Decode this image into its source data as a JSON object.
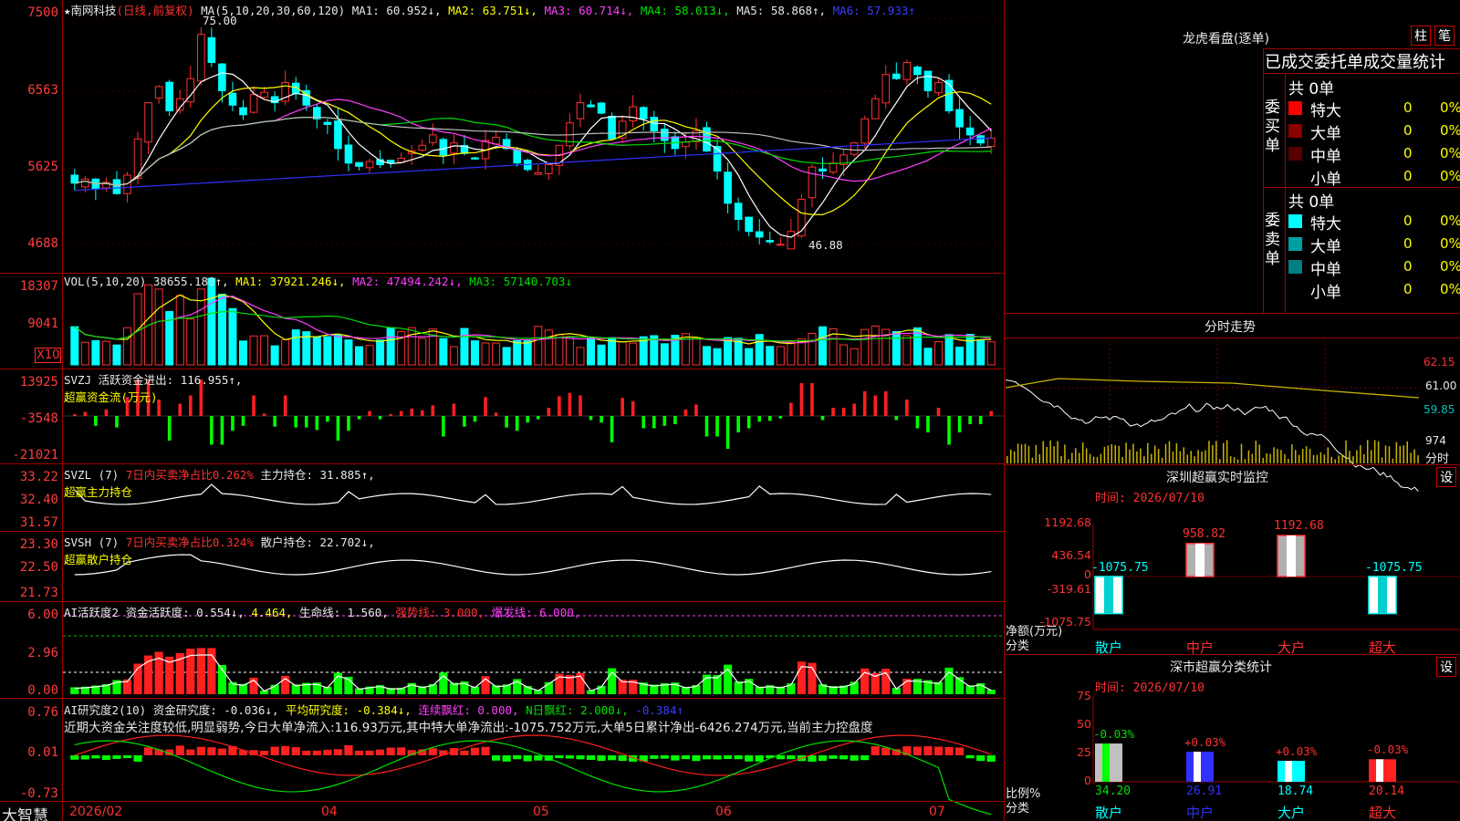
{
  "stock": {
    "name": "★南网科技",
    "period": "(日线,前复权)",
    "ma_label": "MA(5,10,20,30,60,120)",
    "ma1": "MA1: 60.952↓,",
    "ma2": "MA2: 63.751↓,",
    "ma3": "MA3: 60.714↓,",
    "ma4": "MA4: 58.013↓,",
    "ma5": "MA5: 58.868↑,",
    "ma6": "MA6: 57.933↑",
    "high_mark": "75.00",
    "low_mark": "46.88"
  },
  "axes": {
    "price": [
      "7500",
      "6563",
      "5625",
      "4688"
    ],
    "vol": [
      "18307",
      "9041"
    ],
    "vol_mult": "X10",
    "svzj": [
      "13925",
      "-3548",
      "-21021"
    ],
    "svzl": [
      "33.22",
      "32.40",
      "31.57"
    ],
    "svsh": [
      "23.30",
      "22.50",
      "21.73"
    ],
    "ai1": [
      "6.00",
      "2.96",
      "0.00"
    ],
    "ai2": [
      "0.76",
      "0.01",
      "-0.73"
    ]
  },
  "vol_hdr": {
    "label": "VOL(5,10,20)",
    "value": "38655.180↑,",
    "ma1": "MA1: 37921.246↓,",
    "ma2": "MA2: 47494.242↓,",
    "ma3": "MA3: 57140.703↓"
  },
  "svzj_hdr": {
    "label": "SVZJ",
    "text": "活跃资金进出: 116.955↑,",
    "sub": "超赢资金流(万元)"
  },
  "svzl_hdr": {
    "label": "SVZL (7)",
    "t1": "7日内买卖净占比0.262%",
    "t2": "主力持仓: 31.885↑,",
    "sub": "超赢主力持仓"
  },
  "svsh_hdr": {
    "label": "SVSH (7)",
    "t1": "7日内买卖净占比0.324%",
    "t2": "散户持仓: 22.702↓,",
    "sub": "超赢散户持仓"
  },
  "ai1_hdr": {
    "label": "AI活跃度2",
    "t1": "资金活跃度: 0.554↓,",
    "t2": "4.464,",
    "t3": "生命线: 1.560,",
    "t4": "强势线: 3.000,",
    "t5": "爆发线: 6.000,"
  },
  "ai2_hdr": {
    "label": "AI研究度2(10)",
    "t1": "资金研究度: -0.036↓,",
    "t2": "平均研究度: -0.384↓,",
    "t3": "连续飘红: 0.000,",
    "t4": "N日飘红: 2.000↓,",
    "t5": "-0.384↑",
    "comment": "近期大资金关注度较低,明显弱势,今日大单净流入:116.93万元,其中特大单净流出:-1075.752万元,大单5日累计净出-6426.274万元,当前主力控盘度"
  },
  "xaxis": {
    "brand": "大智慧",
    "labels": [
      "2026/02",
      "04",
      "05",
      "06",
      "07"
    ]
  },
  "longhu": {
    "title": "龙虎看盘(逐单)",
    "btn1": "柱",
    "btn2": "笔",
    "head": "已成交委托单成交量统计",
    "buy": {
      "label": "委买单",
      "count": "共 0单",
      "rows": [
        {
          "name": "特大",
          "v": "0",
          "p": "0%",
          "color": "#ff0000"
        },
        {
          "name": "大单",
          "v": "0",
          "p": "0%",
          "color": "#8b0000"
        },
        {
          "name": "中单",
          "v": "0",
          "p": "0%",
          "color": "#5a0000"
        },
        {
          "name": "小单",
          "v": "0",
          "p": "0%",
          "color": ""
        }
      ]
    },
    "sell": {
      "label": "委卖单",
      "count": "共 0单",
      "rows": [
        {
          "name": "特大",
          "v": "0",
          "p": "0%",
          "color": "#00ffff"
        },
        {
          "name": "大单",
          "v": "0",
          "p": "0%",
          "color": "#00a0a0"
        },
        {
          "name": "中单",
          "v": "0",
          "p": "0%",
          "color": "#008080"
        },
        {
          "name": "小单",
          "v": "0",
          "p": "0%",
          "color": ""
        }
      ]
    }
  },
  "fenshi": {
    "title": "分时走势",
    "y": [
      "62.15",
      "61.00",
      "59.85"
    ],
    "vol": "974",
    "unit": "分时"
  },
  "monitor": {
    "title": "深圳超赢实时监控",
    "btn": "设",
    "time": "时间: 2026/07/10",
    "ylabels": [
      "1192.68",
      "436.54",
      "0",
      "-319.61",
      "-1075.75"
    ],
    "ytitle": "净额(万元)",
    "xtitle": "分类",
    "bars": [
      {
        "cat": "散户",
        "v": "-1075.75"
      },
      {
        "cat": "中户",
        "v": "958.82"
      },
      {
        "cat": "大户",
        "v": "1192.68"
      },
      {
        "cat": "超大",
        "v": "-1075.75"
      }
    ]
  },
  "stats": {
    "title": "深市超赢分类统计",
    "btn": "设",
    "time": "时间: 2026/07/10",
    "ylabels": [
      "75",
      "50",
      "25",
      "0"
    ],
    "ytitle": "比例%",
    "xtitle": "分类",
    "bars": [
      {
        "cat": "散户",
        "v": "34.20",
        "d": "-0.03%"
      },
      {
        "cat": "中户",
        "v": "26.91",
        "d": "+0.03%"
      },
      {
        "cat": "大户",
        "v": "18.74",
        "d": "+0.03%"
      },
      {
        "cat": "超大",
        "v": "20.14",
        "d": "-0.03%"
      }
    ]
  },
  "chart_data": [
    {
      "type": "candlestick",
      "title": "南网科技 日线 前复权",
      "ylim": [
        46.88,
        75.0
      ],
      "ma": [
        {
          "name": "MA1",
          "value": 60.952
        },
        {
          "name": "MA2",
          "value": 63.751
        },
        {
          "name": "MA3",
          "value": 60.714
        },
        {
          "name": "MA4",
          "value": 58.013
        },
        {
          "name": "MA5",
          "value": 58.868
        },
        {
          "name": "MA6",
          "value": 57.933
        }
      ],
      "close": [
        54.5,
        55.0,
        53.8,
        54.6,
        53.2,
        55.5,
        60.0,
        64.5,
        66.5,
        63.5,
        65.0,
        67.5,
        73.0,
        69.5,
        66.0,
        64.2,
        63.0,
        65.5,
        65.8,
        64.5,
        67.0,
        65.6,
        64.2,
        62.5,
        61.8,
        58.8,
        57.0,
        56.6,
        57.2,
        56.8,
        57.0,
        57.6,
        58.5,
        59.2,
        60.5,
        58.0,
        59.5,
        58.2,
        57.5,
        59.8,
        60.2,
        58.8,
        57.0,
        56.2,
        55.8,
        56.8,
        59.2,
        62.0,
        64.5,
        64.0,
        63.2,
        60.0,
        62.2,
        64.0,
        62.5,
        61.0,
        59.8,
        58.8,
        59.6,
        61.0,
        58.5,
        56.0,
        52.0,
        50.0,
        48.5,
        47.8,
        47.2,
        46.9,
        48.5,
        52.5,
        56.5,
        56.0,
        57.0,
        58.0,
        59.5,
        62.5,
        65.0,
        68.0,
        67.5,
        69.5,
        68.0,
        66.0,
        67.0,
        63.5,
        61.5,
        60.5,
        59.5,
        60.1
      ]
    },
    {
      "type": "bar",
      "title": "VOL(5,10,20)",
      "ylabel": "X10",
      "series": [
        {
          "name": "VOL",
          "last": 38655.18
        },
        {
          "name": "MA1",
          "last": 37921.246
        },
        {
          "name": "MA2",
          "last": 47494.242
        },
        {
          "name": "MA3",
          "last": 57140.703
        }
      ]
    },
    {
      "type": "bar",
      "title": "超赢资金流(万元)",
      "series": [
        {
          "name": "活跃资金进出",
          "last": 116.955
        }
      ]
    },
    {
      "type": "line",
      "title": "超赢主力持仓",
      "series": [
        {
          "name": "主力持仓",
          "last": 31.885
        }
      ]
    },
    {
      "type": "line",
      "title": "超赢散户持仓",
      "series": [
        {
          "name": "散户持仓",
          "last": 22.702
        }
      ]
    },
    {
      "type": "bar",
      "title": "AI活跃度2",
      "series": [
        {
          "name": "资金活跃度",
          "last": 0.554
        },
        {
          "name": "生命线",
          "last": 1.56
        },
        {
          "name": "强势线",
          "last": 3.0
        },
        {
          "name": "爆发线",
          "last": 6.0
        }
      ]
    },
    {
      "type": "bar",
      "title": "AI研究度2(10)",
      "series": [
        {
          "name": "资金研究度",
          "last": -0.036
        },
        {
          "name": "平均研究度",
          "last": -0.384
        }
      ]
    },
    {
      "type": "bar",
      "title": "深圳超赢实时监控",
      "ylabel": "净额(万元)",
      "categories": [
        "散户",
        "中户",
        "大户",
        "超大"
      ],
      "values": [
        -1075.75,
        958.82,
        1192.68,
        -1075.75
      ]
    },
    {
      "type": "bar",
      "title": "深市超赢分类统计",
      "ylabel": "比例%",
      "categories": [
        "散户",
        "中户",
        "大户",
        "超大"
      ],
      "values": [
        34.2,
        26.91,
        18.74,
        20.14
      ],
      "ylim": [
        0,
        75
      ]
    }
  ]
}
